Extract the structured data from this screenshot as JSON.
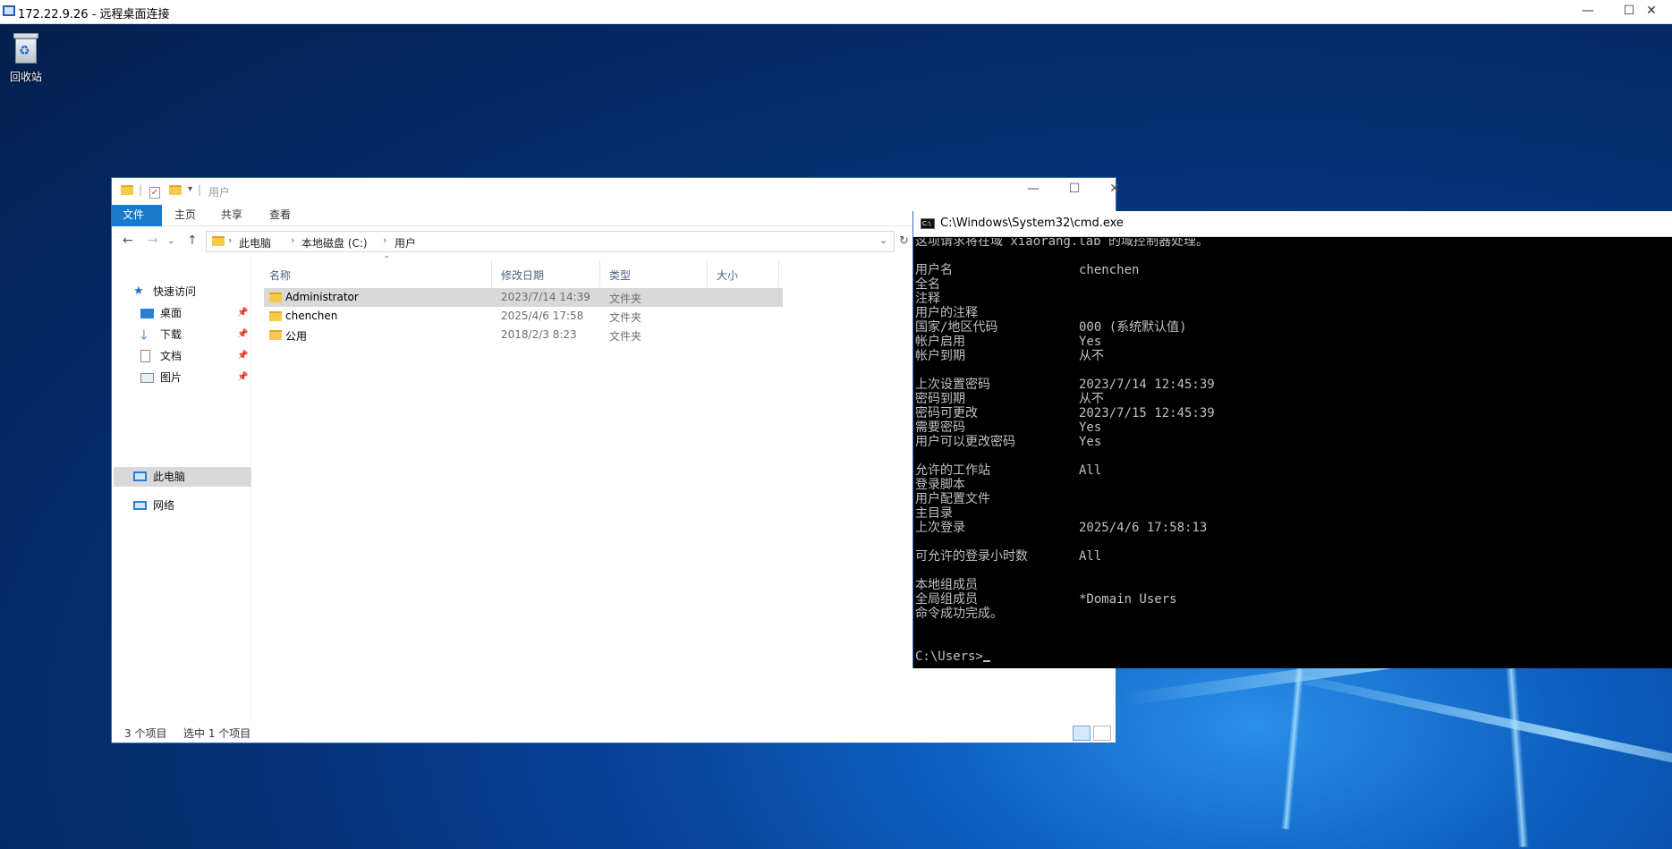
{
  "rdp": {
    "title": "172.22.9.26 - 远程桌面连接",
    "minimize": "—",
    "maximize": "☐",
    "close": "✕"
  },
  "desktop": {
    "recycle_bin_label": "回收站"
  },
  "explorer": {
    "title": "用户",
    "window_controls": {
      "minimize": "—",
      "maximize": "☐",
      "close": "✕"
    },
    "ribbon_tabs": [
      "文件",
      "主页",
      "共享",
      "查看"
    ],
    "address": {
      "segments": [
        "此电脑",
        "本地磁盘 (C:)",
        "用户"
      ],
      "separator": "›"
    },
    "nav": {
      "quick_access": "快速访问",
      "desktop": "桌面",
      "downloads": "下载",
      "documents": "文档",
      "pictures": "图片",
      "this_pc": "此电脑",
      "network": "网络"
    },
    "columns": [
      "名称",
      "修改日期",
      "类型",
      "大小"
    ],
    "rows": [
      {
        "name": "Administrator",
        "date": "2023/7/14 14:39",
        "type": "文件夹",
        "selected": true
      },
      {
        "name": "chenchen",
        "date": "2025/4/6 17:58",
        "type": "文件夹",
        "selected": false
      },
      {
        "name": "公用",
        "date": "2018/2/3 8:23",
        "type": "文件夹",
        "selected": false
      }
    ],
    "status": {
      "count": "3 个项目",
      "selected": "选中 1 个项目"
    }
  },
  "cmd": {
    "title": "C:\\Windows\\System32\\cmd.exe",
    "header": "这项请求将在域 xiaorang.lab 的域控制器处理。",
    "fields": [
      {
        "label": "用户名",
        "value": "chenchen"
      },
      {
        "label": "全名",
        "value": ""
      },
      {
        "label": "注释",
        "value": ""
      },
      {
        "label": "用户的注释",
        "value": ""
      },
      {
        "label": "国家/地区代码",
        "value": "000 (系统默认值)"
      },
      {
        "label": "帐户启用",
        "value": "Yes"
      },
      {
        "label": "帐户到期",
        "value": "从不"
      },
      {
        "label": "上次设置密码",
        "value": "2023/7/14 12:45:39"
      },
      {
        "label": "密码到期",
        "value": "从不"
      },
      {
        "label": "密码可更改",
        "value": "2023/7/15 12:45:39"
      },
      {
        "label": "需要密码",
        "value": "Yes"
      },
      {
        "label": "用户可以更改密码",
        "value": "Yes"
      },
      {
        "label": "允许的工作站",
        "value": "All"
      },
      {
        "label": "登录脚本",
        "value": ""
      },
      {
        "label": "用户配置文件",
        "value": ""
      },
      {
        "label": "主目录",
        "value": ""
      },
      {
        "label": "上次登录",
        "value": "2025/4/6 17:58:13"
      },
      {
        "label": "可允许的登录小时数",
        "value": "All"
      },
      {
        "label": "本地组成员",
        "value": ""
      },
      {
        "label": "全局组成员",
        "value": "*Domain Users"
      }
    ],
    "footer": "命令成功完成。",
    "prompt": "C:\\Users>"
  }
}
